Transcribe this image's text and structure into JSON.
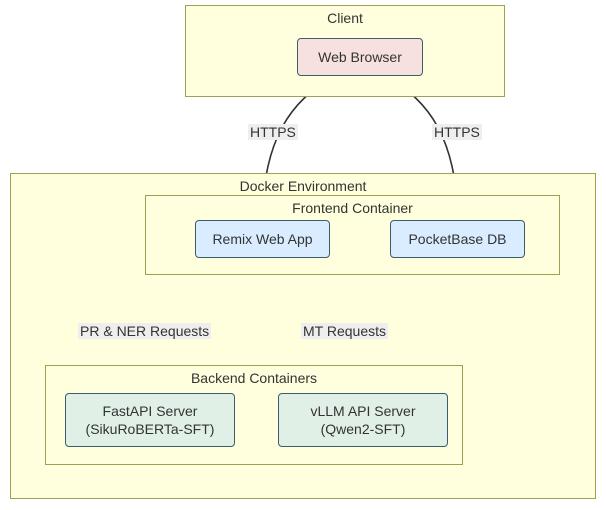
{
  "clusters": {
    "client": {
      "title": "Client"
    },
    "docker": {
      "title": "Docker Environment"
    },
    "frontend": {
      "title": "Frontend Container"
    },
    "backend": {
      "title": "Backend Containers"
    }
  },
  "nodes": {
    "browser": {
      "label": "Web Browser"
    },
    "remix": {
      "label": "Remix Web App"
    },
    "pocketbase": {
      "label": "PocketBase DB"
    },
    "fastapi": {
      "line1": "FastAPI Server",
      "line2": "(SikuRoBERTa-SFT)"
    },
    "vllm": {
      "line1": "vLLM API Server",
      "line2": "(Qwen2-SFT)"
    }
  },
  "edges": {
    "e1": {
      "label": "HTTPS"
    },
    "e2": {
      "label": "HTTPS"
    },
    "e3": {
      "label": "PR & NER Requests"
    },
    "e4": {
      "label": "MT Requests"
    }
  },
  "chart_data": {
    "type": "graph",
    "title": "",
    "clusters": [
      {
        "id": "client",
        "label": "Client",
        "parent": null,
        "children_nodes": [
          "browser"
        ]
      },
      {
        "id": "docker",
        "label": "Docker Environment",
        "parent": null,
        "children_clusters": [
          "frontend",
          "backend"
        ],
        "children_nodes": []
      },
      {
        "id": "frontend",
        "label": "Frontend Container",
        "parent": "docker",
        "children_nodes": [
          "remix",
          "pocketbase"
        ]
      },
      {
        "id": "backend",
        "label": "Backend Containers",
        "parent": "docker",
        "children_nodes": [
          "fastapi",
          "vllm"
        ]
      }
    ],
    "nodes": [
      {
        "id": "browser",
        "label": "Web Browser",
        "color": "pink"
      },
      {
        "id": "remix",
        "label": "Remix Web App",
        "color": "blue"
      },
      {
        "id": "pocketbase",
        "label": "PocketBase DB",
        "color": "blue"
      },
      {
        "id": "fastapi",
        "label": "FastAPI Server\n(SikuRoBERTa-SFT)",
        "color": "green"
      },
      {
        "id": "vllm",
        "label": "vLLM API Server\n(Qwen2-SFT)",
        "color": "green"
      }
    ],
    "edges": [
      {
        "from": "browser",
        "to": "remix",
        "label": "HTTPS"
      },
      {
        "from": "browser",
        "to": "pocketbase",
        "label": "HTTPS"
      },
      {
        "from": "remix",
        "to": "fastapi",
        "label": "PR & NER Requests"
      },
      {
        "from": "remix",
        "to": "vllm",
        "label": "MT Requests"
      }
    ]
  }
}
